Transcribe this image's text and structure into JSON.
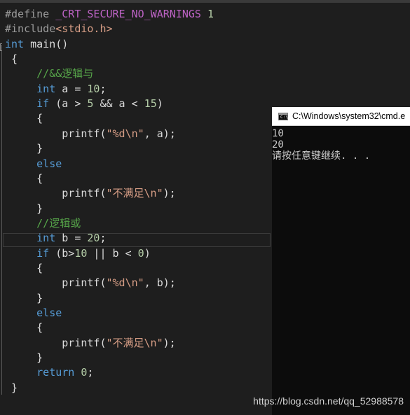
{
  "code": [
    {
      "tokens": [
        {
          "t": "#define ",
          "c": "pp"
        },
        {
          "t": "_CRT_SECURE_NO_WARNINGS",
          "c": "macro"
        },
        {
          "t": " 1",
          "c": "num"
        }
      ]
    },
    {
      "tokens": [
        {
          "t": "#include",
          "c": "pp"
        },
        {
          "t": "<stdio.h>",
          "c": "str"
        }
      ]
    },
    {
      "tokens": [
        {
          "t": "int",
          "c": "kw"
        },
        {
          "t": " main()",
          "c": ""
        }
      ]
    },
    {
      "tokens": [
        {
          "t": " {",
          "c": ""
        }
      ]
    },
    {
      "tokens": [
        {
          "t": "     //&&逻辑与",
          "c": "cm"
        }
      ]
    },
    {
      "tokens": [
        {
          "t": "     ",
          "c": ""
        },
        {
          "t": "int",
          "c": "kw"
        },
        {
          "t": " a = ",
          "c": ""
        },
        {
          "t": "10",
          "c": "num"
        },
        {
          "t": ";",
          "c": ""
        }
      ]
    },
    {
      "tokens": [
        {
          "t": "     ",
          "c": ""
        },
        {
          "t": "if",
          "c": "kw"
        },
        {
          "t": " (a > ",
          "c": ""
        },
        {
          "t": "5",
          "c": "num"
        },
        {
          "t": " && a < ",
          "c": ""
        },
        {
          "t": "15",
          "c": "num"
        },
        {
          "t": ")",
          "c": ""
        }
      ]
    },
    {
      "tokens": [
        {
          "t": "     {",
          "c": ""
        }
      ]
    },
    {
      "tokens": [
        {
          "t": "         printf(",
          "c": ""
        },
        {
          "t": "\"%d\\n\"",
          "c": "str"
        },
        {
          "t": ", a);",
          "c": ""
        }
      ]
    },
    {
      "tokens": [
        {
          "t": "     }",
          "c": ""
        }
      ]
    },
    {
      "tokens": [
        {
          "t": "     ",
          "c": ""
        },
        {
          "t": "else",
          "c": "kw"
        }
      ]
    },
    {
      "tokens": [
        {
          "t": "     {",
          "c": ""
        }
      ]
    },
    {
      "tokens": [
        {
          "t": "         printf(",
          "c": ""
        },
        {
          "t": "\"不满足\\n\"",
          "c": "str"
        },
        {
          "t": ");",
          "c": ""
        }
      ]
    },
    {
      "tokens": [
        {
          "t": "     }",
          "c": ""
        }
      ]
    },
    {
      "tokens": [
        {
          "t": "     //逻辑或",
          "c": "cm"
        }
      ]
    },
    {
      "tokens": [
        {
          "t": "     ",
          "c": ""
        },
        {
          "t": "int",
          "c": "kw"
        },
        {
          "t": " b = ",
          "c": ""
        },
        {
          "t": "20",
          "c": "num"
        },
        {
          "t": ";",
          "c": ""
        }
      ]
    },
    {
      "tokens": [
        {
          "t": "     ",
          "c": ""
        },
        {
          "t": "if",
          "c": "kw"
        },
        {
          "t": " (b>",
          "c": ""
        },
        {
          "t": "10",
          "c": "num"
        },
        {
          "t": " || b < ",
          "c": ""
        },
        {
          "t": "0",
          "c": "num"
        },
        {
          "t": ")",
          "c": ""
        }
      ]
    },
    {
      "tokens": [
        {
          "t": "     {",
          "c": ""
        }
      ]
    },
    {
      "tokens": [
        {
          "t": "         printf(",
          "c": ""
        },
        {
          "t": "\"%d\\n\"",
          "c": "str"
        },
        {
          "t": ", b);",
          "c": ""
        }
      ]
    },
    {
      "tokens": [
        {
          "t": "     }",
          "c": ""
        }
      ]
    },
    {
      "tokens": [
        {
          "t": "     ",
          "c": ""
        },
        {
          "t": "else",
          "c": "kw"
        }
      ]
    },
    {
      "tokens": [
        {
          "t": "     {",
          "c": ""
        }
      ]
    },
    {
      "tokens": [
        {
          "t": "         printf(",
          "c": ""
        },
        {
          "t": "\"不满足\\n\"",
          "c": "str"
        },
        {
          "t": ");",
          "c": ""
        }
      ]
    },
    {
      "tokens": [
        {
          "t": "     }",
          "c": ""
        }
      ]
    },
    {
      "tokens": [
        {
          "t": "     ",
          "c": ""
        },
        {
          "t": "return",
          "c": "kw"
        },
        {
          "t": " ",
          "c": ""
        },
        {
          "t": "0",
          "c": "num"
        },
        {
          "t": ";",
          "c": ""
        }
      ]
    },
    {
      "tokens": [
        {
          "t": " }",
          "c": ""
        }
      ]
    }
  ],
  "console": {
    "title": "C:\\Windows\\system32\\cmd.e",
    "icon": "cmd-icon",
    "icon_text": "C:\\",
    "output": [
      "10",
      "20",
      "请按任意键继续. . ."
    ]
  },
  "watermark": "https://blog.csdn.net/qq_52988578",
  "colors": {
    "background": "#1e1e1e",
    "keyword": "#569cd6",
    "comment": "#57a64a",
    "string": "#d69d85",
    "macro": "#bd63c5",
    "console_bg": "#0c0c0c"
  }
}
